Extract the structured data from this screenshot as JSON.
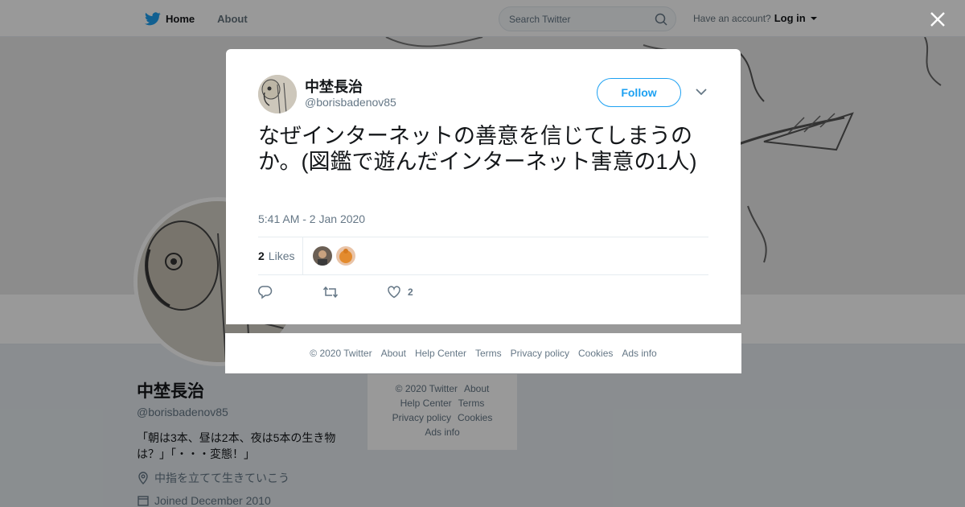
{
  "nav": {
    "home_label": "Home",
    "about_label": "About",
    "search_placeholder": "Search Twitter",
    "have_account": "Have an account?",
    "login_label": "Log in"
  },
  "profile": {
    "name": "中埜長治",
    "handle": "@borisbadenov85",
    "bio": "「朝は3本、昼は2本、夜は5本の生き物は？」「・・・変態！」",
    "location": "中指を立てて生きていこう",
    "joined": "Joined December 2010"
  },
  "side_footer": {
    "copyright": "© 2020 Twitter",
    "about": "About",
    "help": "Help Center",
    "terms": "Terms",
    "privacy": "Privacy policy",
    "cookies": "Cookies",
    "ads": "Ads info"
  },
  "tweet": {
    "author_name": "中埜長治",
    "author_handle": "@borisbadenov85",
    "follow_label": "Follow",
    "text": "なぜインターネットの善意を信じてしまうのか。(図鑑で遊んだインターネット害意の1人)",
    "timestamp": "5:41 AM - 2 Jan 2020",
    "likes_count": "2",
    "likes_label": "Likes",
    "like_action_count": "2"
  },
  "modal_footer": {
    "copyright": "© 2020 Twitter",
    "about": "About",
    "help": "Help Center",
    "terms": "Terms",
    "privacy": "Privacy policy",
    "cookies": "Cookies",
    "ads": "Ads info"
  },
  "colors": {
    "accent": "#1da1f2",
    "muted": "#657786",
    "text": "#14171a"
  },
  "icons": [
    "twitter-bird-icon",
    "search-icon",
    "caret-down-icon",
    "close-icon",
    "chevron-down-icon",
    "reply-icon",
    "retweet-icon",
    "heart-icon",
    "location-icon",
    "calendar-icon"
  ]
}
